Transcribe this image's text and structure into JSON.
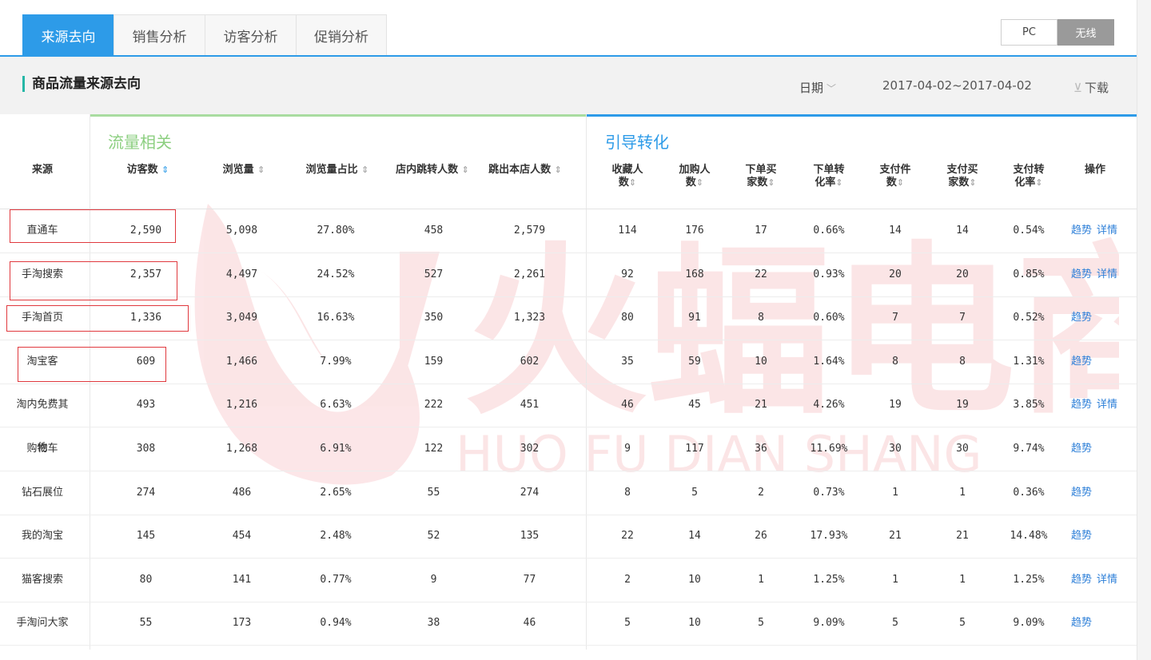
{
  "tabs": [
    "来源去向",
    "销售分析",
    "访客分析",
    "促销分析"
  ],
  "device_toggle": {
    "pc": "PC",
    "wireless": "无线"
  },
  "section": {
    "title": "商品流量来源去向",
    "date_label": "日期",
    "date_range": "2017-04-02~2017-04-02",
    "download": "下载"
  },
  "groups": {
    "traffic": "流量相关",
    "conversion": "引导转化"
  },
  "columns": {
    "source": "来源",
    "visitors": [
      "访客数"
    ],
    "pageviews": [
      "浏览量"
    ],
    "pv_share": [
      "浏览量占比"
    ],
    "internal_jump": [
      "店内跳转人数"
    ],
    "exit": [
      "跳出本店人数"
    ],
    "favorites": [
      "收藏人",
      "数"
    ],
    "cart": [
      "加购人",
      "数"
    ],
    "order_buyers": [
      "下单买",
      "家数"
    ],
    "order_rate": [
      "下单转",
      "化率"
    ],
    "pay_items": [
      "支付件",
      "数"
    ],
    "pay_buyers": [
      "支付买",
      "家数"
    ],
    "pay_rate": [
      "支付转",
      "化率"
    ],
    "ops": "操作"
  },
  "sort_icon": "⇕",
  "actions": {
    "trend": "趋势",
    "detail": "详情"
  },
  "rows": [
    {
      "source": "直通车",
      "visitors": "2,590",
      "pageviews": "5,098",
      "pv_share": "27.80%",
      "internal_jump": "458",
      "exit": "2,579",
      "favorites": "114",
      "cart": "176",
      "order_buyers": "17",
      "order_rate": "0.66%",
      "pay_items": "14",
      "pay_buyers": "14",
      "pay_rate": "0.54%",
      "detail": true
    },
    {
      "source": "手淘搜索",
      "visitors": "2,357",
      "pageviews": "4,497",
      "pv_share": "24.52%",
      "internal_jump": "527",
      "exit": "2,261",
      "favorites": "92",
      "cart": "168",
      "order_buyers": "22",
      "order_rate": "0.93%",
      "pay_items": "20",
      "pay_buyers": "20",
      "pay_rate": "0.85%",
      "detail": true
    },
    {
      "source": "手淘首页",
      "visitors": "1,336",
      "pageviews": "3,049",
      "pv_share": "16.63%",
      "internal_jump": "350",
      "exit": "1,323",
      "favorites": "80",
      "cart": "91",
      "order_buyers": "8",
      "order_rate": "0.60%",
      "pay_items": "7",
      "pay_buyers": "7",
      "pay_rate": "0.52%",
      "detail": false
    },
    {
      "source": "淘宝客",
      "visitors": "609",
      "pageviews": "1,466",
      "pv_share": "7.99%",
      "internal_jump": "159",
      "exit": "602",
      "favorites": "35",
      "cart": "59",
      "order_buyers": "10",
      "order_rate": "1.64%",
      "pay_items": "8",
      "pay_buyers": "8",
      "pay_rate": "1.31%",
      "detail": false
    },
    {
      "source": "淘内免费其他",
      "visitors": "493",
      "pageviews": "1,216",
      "pv_share": "6.63%",
      "internal_jump": "222",
      "exit": "451",
      "favorites": "46",
      "cart": "45",
      "order_buyers": "21",
      "order_rate": "4.26%",
      "pay_items": "19",
      "pay_buyers": "19",
      "pay_rate": "3.85%",
      "detail": true
    },
    {
      "source": "购物车",
      "visitors": "308",
      "pageviews": "1,268",
      "pv_share": "6.91%",
      "internal_jump": "122",
      "exit": "302",
      "favorites": "9",
      "cart": "117",
      "order_buyers": "36",
      "order_rate": "11.69%",
      "pay_items": "30",
      "pay_buyers": "30",
      "pay_rate": "9.74%",
      "detail": false
    },
    {
      "source": "钻石展位",
      "visitors": "274",
      "pageviews": "486",
      "pv_share": "2.65%",
      "internal_jump": "55",
      "exit": "274",
      "favorites": "8",
      "cart": "5",
      "order_buyers": "2",
      "order_rate": "0.73%",
      "pay_items": "1",
      "pay_buyers": "1",
      "pay_rate": "0.36%",
      "detail": false
    },
    {
      "source": "我的淘宝",
      "visitors": "145",
      "pageviews": "454",
      "pv_share": "2.48%",
      "internal_jump": "52",
      "exit": "135",
      "favorites": "22",
      "cart": "14",
      "order_buyers": "26",
      "order_rate": "17.93%",
      "pay_items": "21",
      "pay_buyers": "21",
      "pay_rate": "14.48%",
      "detail": false
    },
    {
      "source": "猫客搜索",
      "visitors": "80",
      "pageviews": "141",
      "pv_share": "0.77%",
      "internal_jump": "9",
      "exit": "77",
      "favorites": "2",
      "cart": "10",
      "order_buyers": "1",
      "order_rate": "1.25%",
      "pay_items": "1",
      "pay_buyers": "1",
      "pay_rate": "1.25%",
      "detail": true
    },
    {
      "source": "手淘问大家",
      "visitors": "55",
      "pageviews": "173",
      "pv_share": "0.94%",
      "internal_jump": "38",
      "exit": "46",
      "favorites": "5",
      "cart": "10",
      "order_buyers": "5",
      "order_rate": "9.09%",
      "pay_items": "5",
      "pay_buyers": "5",
      "pay_rate": "9.09%",
      "detail": false
    }
  ],
  "watermark": {
    "cn": "火蝠电商",
    "en": "HUO FU DIAN SHANG"
  },
  "colors": {
    "accent": "#2d9be8",
    "traffic_green": "#8ccf80",
    "highlight_red": "#e0393e",
    "link": "#2d7fd8",
    "watermark": "#e8404a"
  }
}
